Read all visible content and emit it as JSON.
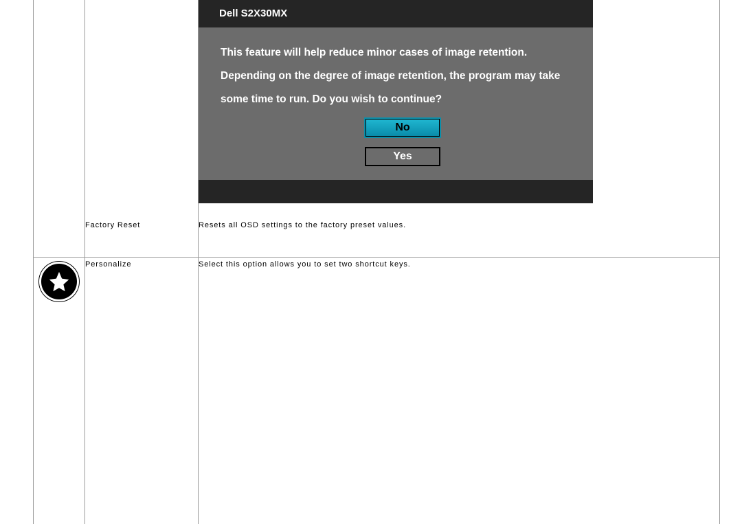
{
  "osd": {
    "title": "Dell S2X30MX",
    "message": "This feature will help reduce minor cases of image retention. Depending on the degree of image retention, the program may take some time to run. Do you wish to continue?",
    "no_label": "No",
    "yes_label": "Yes"
  },
  "rows": {
    "factory_reset": {
      "label": "Factory Reset",
      "description": "Resets all OSD settings to the factory preset values."
    },
    "personalize": {
      "label": "Personalize",
      "description": "Select this option allows you to set two shortcut keys."
    }
  }
}
